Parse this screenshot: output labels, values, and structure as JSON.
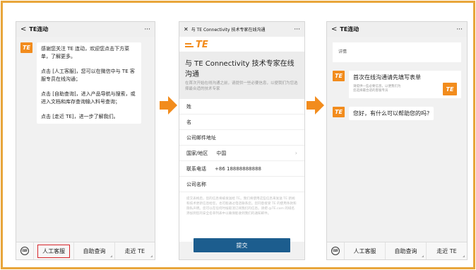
{
  "colors": {
    "accent": "#f28c1d",
    "frame": "#e8a53a",
    "submit": "#1c5d8e",
    "highlight": "#d6262b"
  },
  "panel1": {
    "back": "<",
    "title": "TE连动",
    "more": "···",
    "logo": "TE",
    "messages": [
      "感谢您关注 TE 连动，欢迎您点击下方菜单，了解更多。",
      "点击 [人工客服]，您可以在微信中与 TE 客服专员在线沟通；",
      "点击 [自助查询]，进入产品导航与搜索，或进入文档和库存查询输入料号查询；",
      "点击 [走近 TE]，进一步了解我们。"
    ],
    "nav": [
      "人工客服",
      "自助查询",
      "走近 TE"
    ]
  },
  "panel2": {
    "close": "✕",
    "title": "与 TE Connectivity 技术专家在线沟通",
    "more": "···",
    "logo": "TE",
    "heading": "与 TE Connectivity 技术专家在线沟通",
    "subtext": "在首次开始在线沟通之前，请提供一些必要信息，以便我们为您选择最合适的技术专家",
    "fields": [
      {
        "label": "姓",
        "value": ""
      },
      {
        "label": "名",
        "value": ""
      },
      {
        "label": "公司邮件地址",
        "value": ""
      },
      {
        "label": "国家/地区",
        "value": "中国",
        "chevron": "›"
      },
      {
        "label": "联系电话",
        "value": "+86 18888888888"
      },
      {
        "label": "公司名称",
        "value": ""
      }
    ],
    "consent": "提交表格后，您的信息将被发送给 TE。我们将使用这些信息来发送 TE 新闻和技术更新信息给您，也可能通过电话联系您。您同意接受 TE 的使用条款和隐私声明。您可以在任何时候取消订阅我们的信息。请把 @TE.com 的域名添加到您的安全名单列表中以确保能收到我们的通知邮件。",
    "submit": "提交"
  },
  "panel3": {
    "back": "<",
    "title": "TE连动",
    "more": "···",
    "detail": "详情",
    "card_title": "首次在线沟通请先填写表单",
    "card_sub": "请提供一些必要信息，以便我们为您选择最合适的客服专员",
    "logo": "TE",
    "greeting": "您好，有什么可以帮助您的吗?",
    "nav": [
      "人工客服",
      "自助查询",
      "走近 TE"
    ]
  }
}
